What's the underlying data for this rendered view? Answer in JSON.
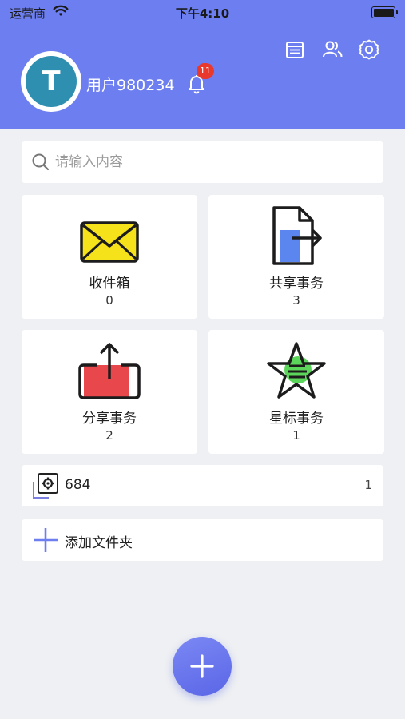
{
  "status_bar": {
    "carrier": "运营商",
    "time": "下午4:10"
  },
  "header": {
    "avatar_letter": "T",
    "username": "用户980234",
    "notification_count": "11",
    "icons": [
      "calendar-icon",
      "contacts-icon",
      "settings-icon"
    ]
  },
  "search": {
    "placeholder": "请输入内容"
  },
  "cards": [
    {
      "title": "收件箱",
      "count": "0",
      "icon": "inbox-envelope-icon"
    },
    {
      "title": "共享事务",
      "count": "3",
      "icon": "shared-document-icon"
    },
    {
      "title": "分享事务",
      "count": "2",
      "icon": "share-upload-icon"
    },
    {
      "title": "星标事务",
      "count": "1",
      "icon": "star-icon"
    }
  ],
  "folder": {
    "name": "684",
    "count": "1",
    "icon": "folder-settings-icon"
  },
  "add_folder": {
    "label": "添加文件夹",
    "icon": "plus-icon"
  },
  "colors": {
    "header": "#6d7ff0",
    "accent": "#5a66e6",
    "badge": "#e8392c",
    "avatar": "#2e8fb0",
    "envelope": "#f5e21a",
    "doc": "#5b86f0",
    "share_box": "#e8474c",
    "star_fill": "#5bd65a"
  }
}
